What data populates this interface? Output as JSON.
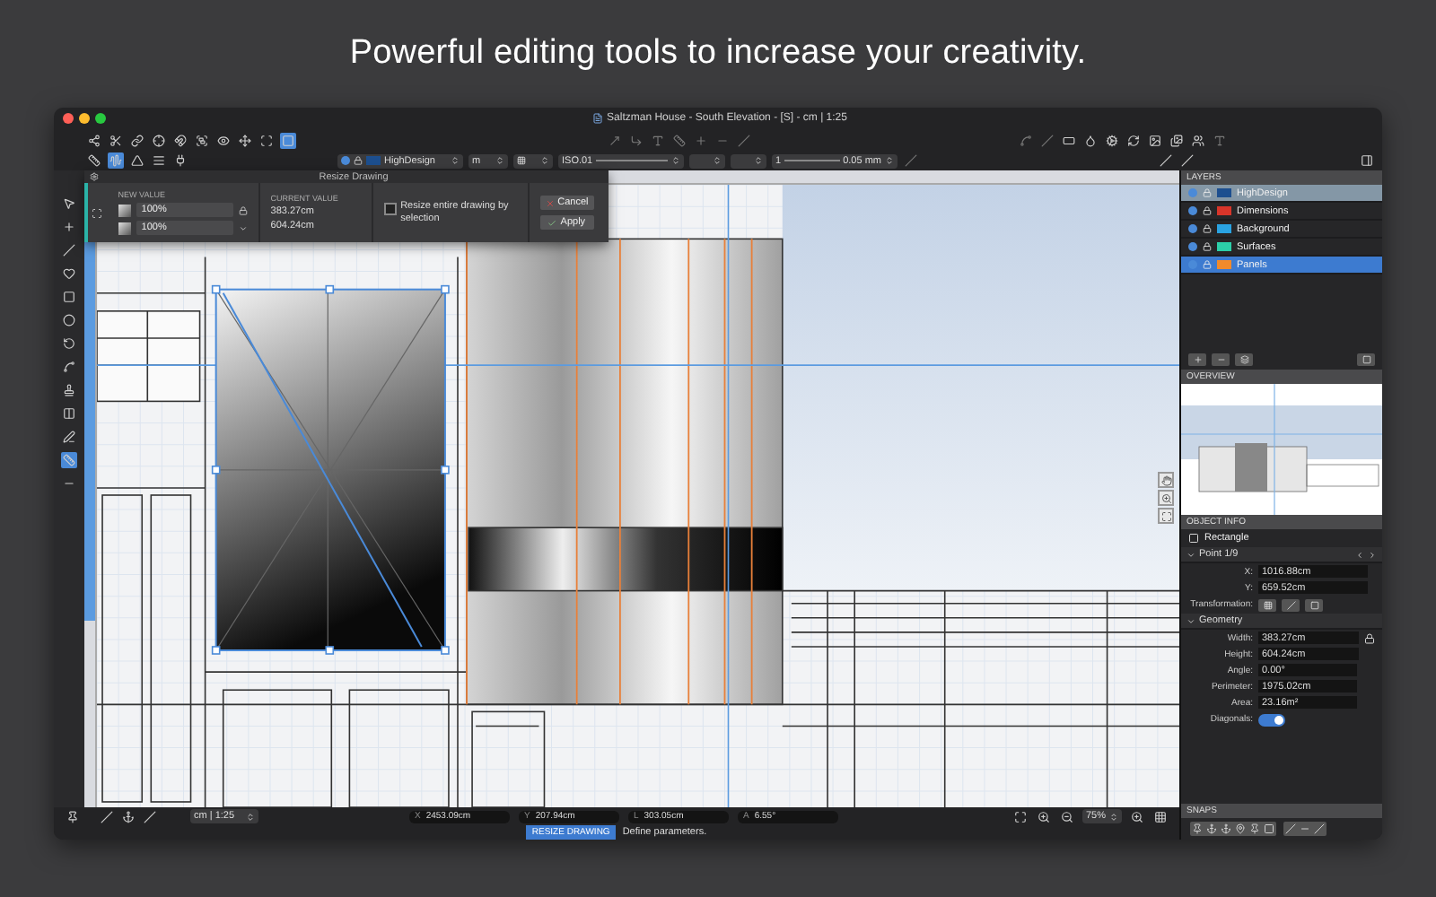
{
  "headline": "Powerful editing tools to increase your creativity.",
  "window": {
    "title": "Saltzman House - South Elevation - [S] - cm | 1:25"
  },
  "toolbar": {
    "layer": "HighDesign",
    "unit": "m",
    "line_type": "ISO.01",
    "pen": "1",
    "thickness": "0.05 mm"
  },
  "resize_dialog": {
    "title": "Resize Drawing",
    "new_value_heading": "NEW VALUE",
    "new_values": [
      "100%",
      "100%"
    ],
    "current_value_heading": "CURRENT VALUE",
    "current_values": [
      "383.27cm",
      "604.24cm"
    ],
    "option": {
      "label": "Resize entire drawing by selection",
      "checked": false
    },
    "buttons": [
      {
        "label": "Cancel",
        "kind": "cancel"
      },
      {
        "label": "Apply",
        "kind": "apply"
      }
    ]
  },
  "layers": {
    "title": "LAYERS",
    "items": [
      {
        "name": "HighDesign",
        "color": "#1d4f8f",
        "active": true,
        "selected": false
      },
      {
        "name": "Dimensions",
        "color": "#d8352a",
        "active": false,
        "selected": false
      },
      {
        "name": "Background",
        "color": "#2aa3e2",
        "active": false,
        "selected": false
      },
      {
        "name": "Surfaces",
        "color": "#2ccfa9",
        "active": false,
        "selected": false
      },
      {
        "name": "Panels",
        "color": "#f08a2c",
        "active": false,
        "selected": true
      }
    ]
  },
  "overview": {
    "title": "OVERVIEW"
  },
  "object_info": {
    "title": "OBJECT INFO",
    "object_type": "Rectangle",
    "point": {
      "title": "Point 1/9",
      "expanded": true,
      "fields": [
        {
          "label": "X:",
          "value": "1016.88cm"
        },
        {
          "label": "Y:",
          "value": "659.52cm"
        }
      ],
      "transformation_label": "Transformation:"
    },
    "geometry": {
      "title": "Geometry",
      "expanded": true,
      "fields": [
        {
          "label": "Width:",
          "value": "383.27cm"
        },
        {
          "label": "Height:",
          "value": "604.24cm"
        },
        {
          "label": "Angle:",
          "value": "0.00°"
        },
        {
          "label": "Perimeter:",
          "value": "1975.02cm"
        },
        {
          "label": "Area:",
          "value": "23.16m²"
        }
      ],
      "diagonals": {
        "label": "Diagonals:",
        "on": true
      }
    }
  },
  "snaps": {
    "title": "SNAPS"
  },
  "bottom_bar": {
    "scale": "cm | 1:25",
    "coordinates": [
      {
        "label": "X",
        "value": "2453.09cm"
      },
      {
        "label": "Y",
        "value": "207.94cm"
      },
      {
        "label": "L",
        "value": "303.05cm"
      },
      {
        "label": "A",
        "value": "6.55°"
      }
    ],
    "zoom": "75%"
  },
  "status": {
    "mode": "RESIZE DRAWING",
    "message": "Define parameters."
  }
}
